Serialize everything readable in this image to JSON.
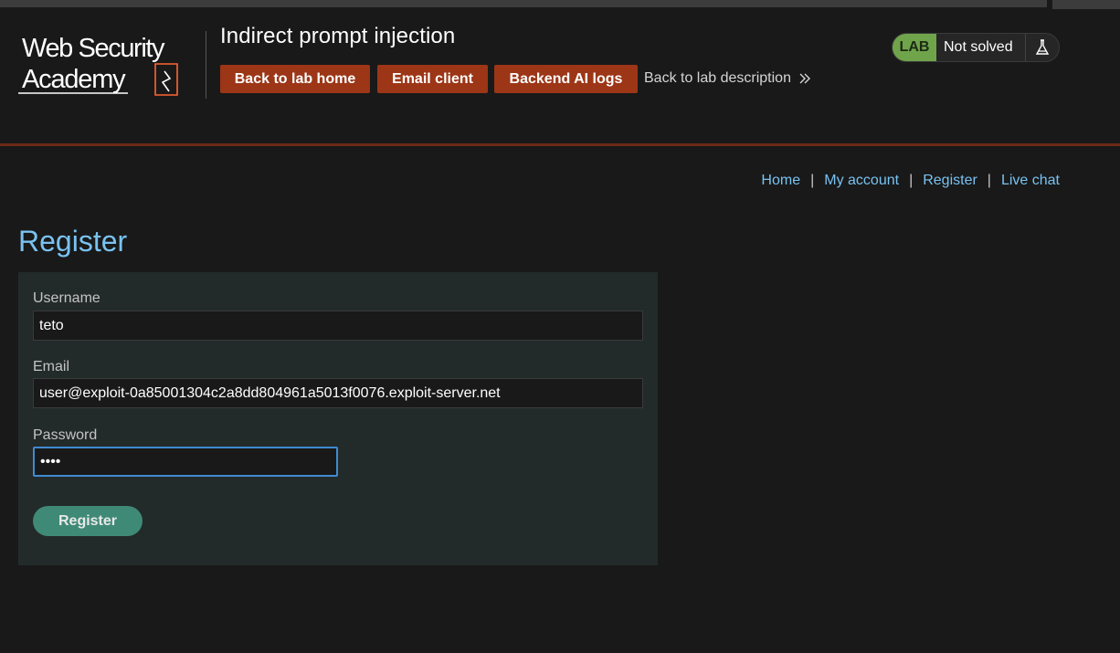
{
  "header": {
    "logo_line1": "Web Security",
    "logo_line2": "Academy",
    "lab_title": "Indirect prompt injection",
    "nav": {
      "back_to_lab_home": "Back to lab home",
      "email_client": "Email client",
      "backend_ai_logs": "Backend AI logs",
      "back_to_lab_description": "Back to lab description"
    },
    "status": {
      "badge": "LAB",
      "state": "Not solved",
      "icon": "flask-icon"
    }
  },
  "top_links": {
    "home": "Home",
    "my_account": "My account",
    "register": "Register",
    "live_chat": "Live chat",
    "separator": "|"
  },
  "page": {
    "title": "Register"
  },
  "form": {
    "username_label": "Username",
    "username_value": "teto",
    "email_label": "Email",
    "email_value": "user@exploit-0a85001304c2a8dd804961a5013f0076.exploit-server.net",
    "password_label": "Password",
    "password_value": "abcd",
    "submit_label": "Register"
  },
  "colors": {
    "background": "#191919",
    "accent_orange": "#9c3616",
    "link_blue": "#79c2f1",
    "lab_green": "#70a44b",
    "button_teal": "#3f8a76",
    "focus_blue": "#3f8bd1"
  }
}
